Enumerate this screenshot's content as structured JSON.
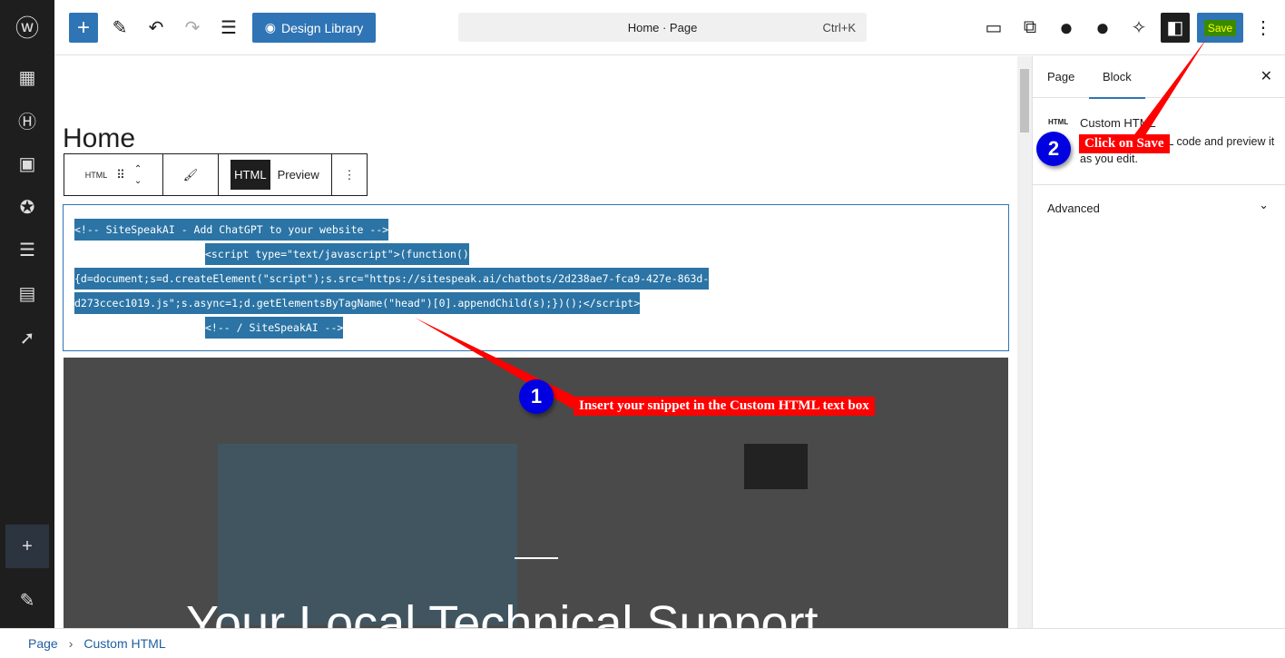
{
  "topbar": {
    "design_library": "Design Library",
    "command": "Home · Page",
    "shortcut": "Ctrl+K",
    "save": "Save"
  },
  "editor": {
    "page_title": "Home",
    "toolbar": {
      "block_type": "HTML",
      "html_tab": "HTML",
      "preview_tab": "Preview"
    },
    "code_lines": [
      "<!-- SiteSpeakAI - Add ChatGPT to your website -->",
      "<script type=\"text/javascript\">(function()",
      "{d=document;s=d.createElement(\"script\");s.src=\"https://sitespeak.ai/chatbots/2d238ae7-fca9-427e-863d-",
      "d273ccec1019.js\";s.async=1;d.getElementsByTagName(\"head\")[0].appendChild(s);})();</script>",
      "<!-- / SiteSpeakAI -->"
    ],
    "hero_title": "Your Local Technical Support"
  },
  "panel": {
    "tabs": [
      "Page",
      "Block"
    ],
    "block_icon": "HTML",
    "block_name": "Custom HTML",
    "block_desc": "Add custom HTML code and preview it as you edit.",
    "advanced": "Advanced"
  },
  "breadcrumb": [
    "Page",
    "Custom HTML"
  ],
  "annotations": {
    "step1_num": "1",
    "step1_text": "Insert your snippet in the Custom HTML text box",
    "step2_num": "2",
    "step2_text": "Click on Save"
  }
}
